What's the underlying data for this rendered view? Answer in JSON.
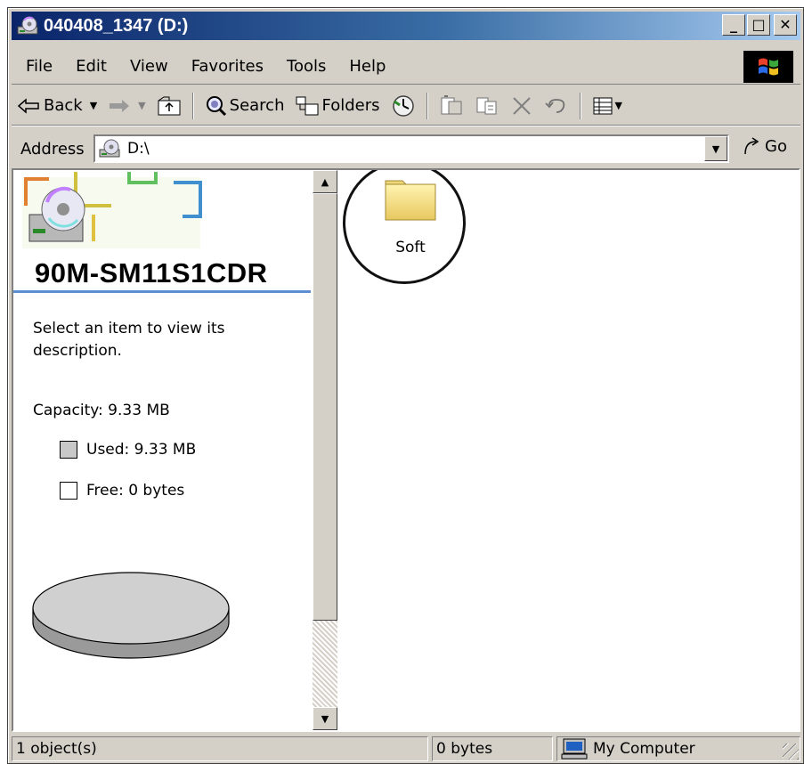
{
  "window": {
    "title": "040408_1347 (D:)",
    "icon": "cd-drive-icon",
    "controls": [
      "_",
      "□",
      "✕"
    ]
  },
  "menu": {
    "items": [
      "File",
      "Edit",
      "View",
      "Favorites",
      "Tools",
      "Help"
    ]
  },
  "toolbar": {
    "back_label": "Back",
    "search_label": "Search",
    "folders_label": "Folders"
  },
  "address": {
    "label": "Address",
    "value": "D:\\",
    "go_label": "Go"
  },
  "leftpane": {
    "drive_name": "90M-SM11S1CDR",
    "description": "Select an item to view its description.",
    "capacity": "Capacity: 9.33 MB",
    "used": "Used: 9.33 MB",
    "free": "Free: 0 bytes",
    "used_fraction": 1.0
  },
  "files": [
    {
      "name": "Soft",
      "type": "folder",
      "icon": "folder-icon"
    }
  ],
  "status": {
    "objects": "1 object(s)",
    "size": "0 bytes",
    "zone": "My Computer"
  },
  "colors": {
    "titlebar_start": "#0a246a",
    "titlebar_end": "#a6caf0",
    "chrome": "#d4d0c8",
    "rule": "#5b8fd1"
  }
}
